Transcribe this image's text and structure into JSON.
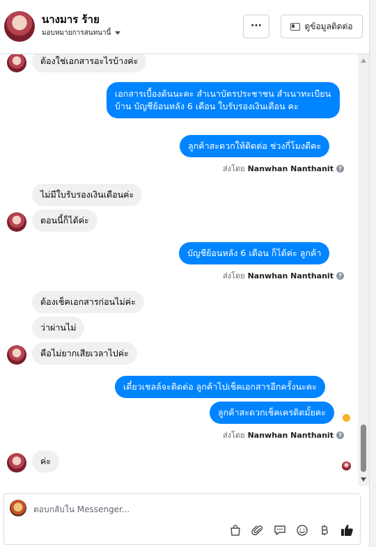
{
  "header": {
    "name": "นางมาร ร้าย",
    "assign_label": "มอบหมายการสนทนานี้",
    "more_label": "···",
    "contact_label": "ดูข้อมูลติดต่อ"
  },
  "messages": {
    "m1": "ต้องใช่เอกสารอะไรบ้างค่ะ",
    "m2": "เอกสารเบื้องต้นนะคะ  สำเนาบัตรประชาชน สำเนาทะเบียนบ้าน  บัญชีย้อนหลัง 6 เดือน  ใบรับรองเงินเดือน คะ",
    "m3": "ลูกค้าสะดวกให้ติดต่อ ช่วงกี่โมงดีคะ",
    "m4": "ไม่มีใบรับรองเงินเดือนค่ะ",
    "m5": "ตอนนี้ก็ได้ค่ะ",
    "m6": "บัญชีย้อนหลัง 6 เดือน ก็ได้ค่ะ ลูกค้า",
    "m7": "ต้องเช็คเอกสารก่อนไม่ค่ะ",
    "m8": "ว่าผ่านไม่",
    "m9": "คือไม่ยากเสียเวลาไปค่ะ",
    "m10": "เดี๋ยวเชลล์จะติดต่อ ลูกค้าไปเช็คเอกสารอีกครั้งนะคะ",
    "m11": "ลูกค้าสะดวกเช็คเครดิตมั้ยคะ",
    "m12": "ค่ะ"
  },
  "sent_by": {
    "prefix": "ส่งโดย",
    "name": "Nanwhan Nanthanit",
    "help_icon": "?"
  },
  "composer": {
    "placeholder": "ตอบกลับใน Messenger..."
  },
  "colors": {
    "outgoing_bubble": "#0084ff",
    "incoming_bubble": "#f0f0f0",
    "like_icon": "#1c1e21"
  }
}
